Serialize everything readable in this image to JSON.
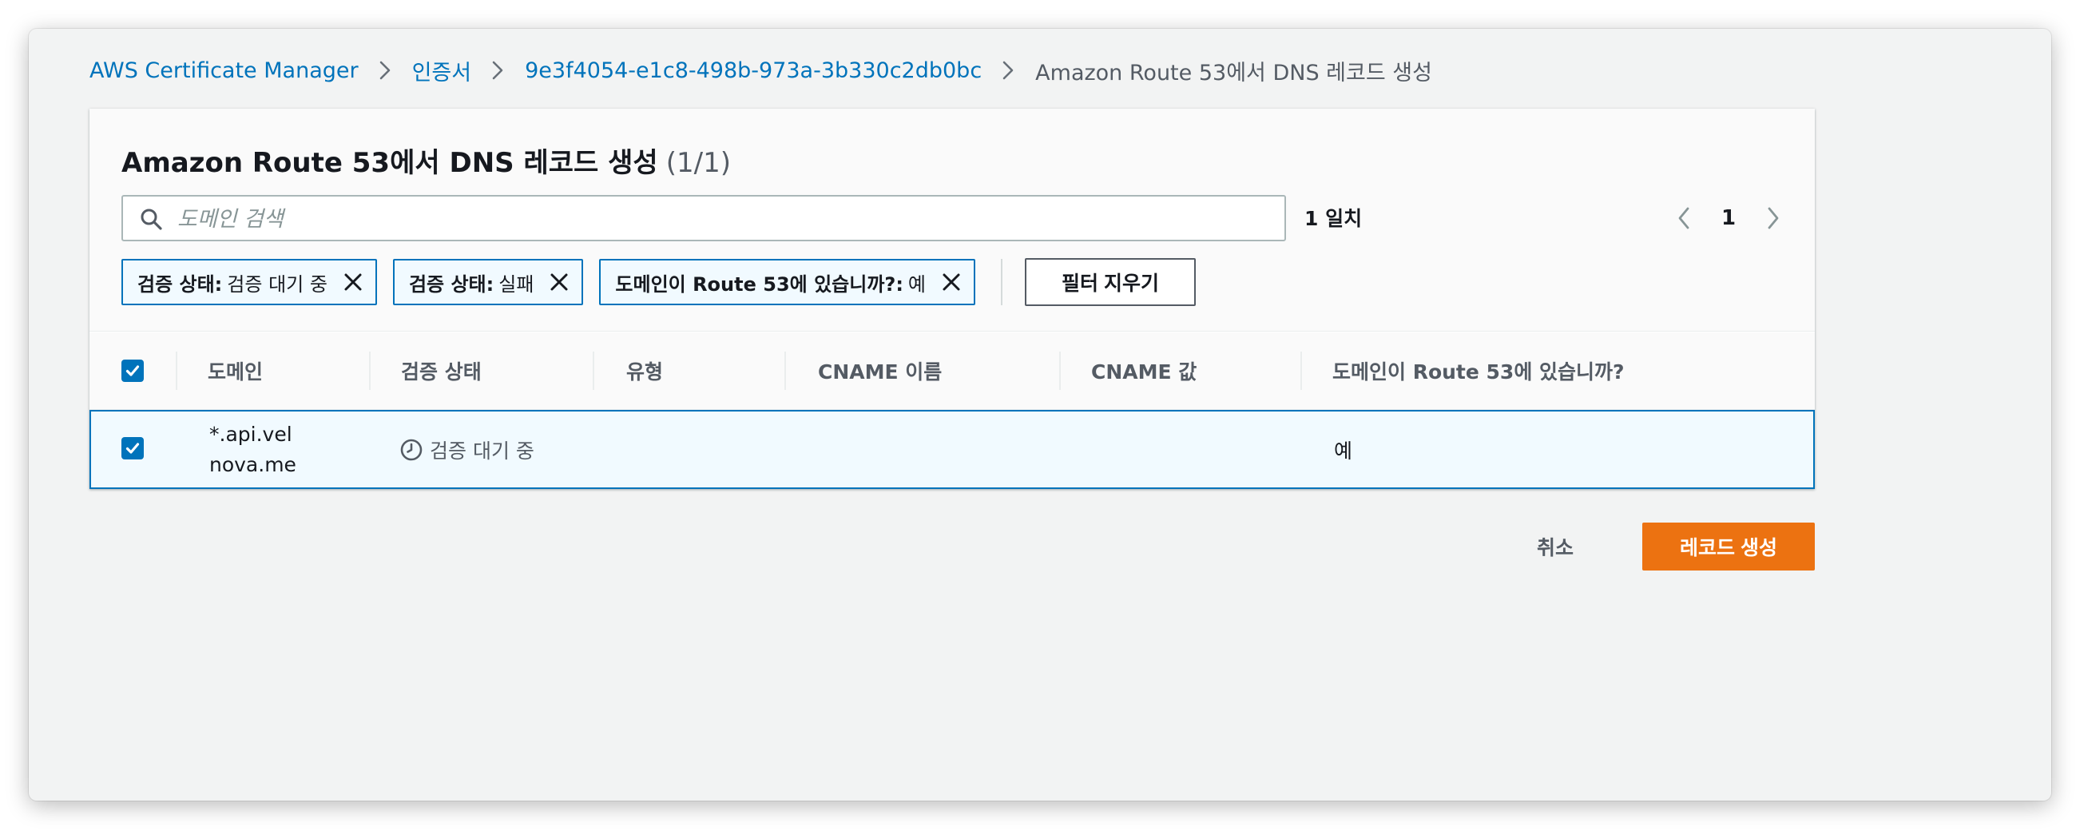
{
  "colors": {
    "link": "#0073bb",
    "primary_button": "#ec7211",
    "selected_row_bg": "#f1faff",
    "page_bg": "#f2f3f3"
  },
  "breadcrumb": {
    "items": [
      {
        "label": "AWS Certificate Manager"
      },
      {
        "label": "인증서"
      },
      {
        "label": "9e3f4054-e1c8-498b-973a-3b330c2db0bc"
      }
    ],
    "current": "Amazon Route 53에서 DNS 레코드 생성"
  },
  "panel": {
    "title": "Amazon Route 53에서 DNS 레코드 생성",
    "count": "(1/1)"
  },
  "search": {
    "placeholder": "도메인 검색",
    "value": "",
    "icon": "search-icon",
    "matches": "1 일치"
  },
  "pagination": {
    "current_page": "1",
    "prev_icon": "chevron-left-icon",
    "next_icon": "chevron-right-icon"
  },
  "filters": {
    "tokens": [
      {
        "key": "검증 상태:",
        "value": "검증 대기 중"
      },
      {
        "key": "검증 상태:",
        "value": "실패"
      },
      {
        "key": "도메인이 Route 53에 있습니까?:",
        "value": "예"
      }
    ],
    "clear_label": "필터 지우기"
  },
  "table": {
    "select_all_checked": true,
    "columns": [
      "도메인",
      "검증 상태",
      "유형",
      "CNAME 이름",
      "CNAME 값",
      "도메인이 Route 53에 있습니까?"
    ],
    "rows": [
      {
        "checked": true,
        "domain": "*.api.velnova.me",
        "status": "검증 대기 중",
        "status_icon": "clock-icon",
        "type": "",
        "cname_name": "",
        "cname_value": "",
        "in_route53": "예"
      }
    ]
  },
  "actions": {
    "cancel_label": "취소",
    "create_label": "레코드 생성"
  }
}
